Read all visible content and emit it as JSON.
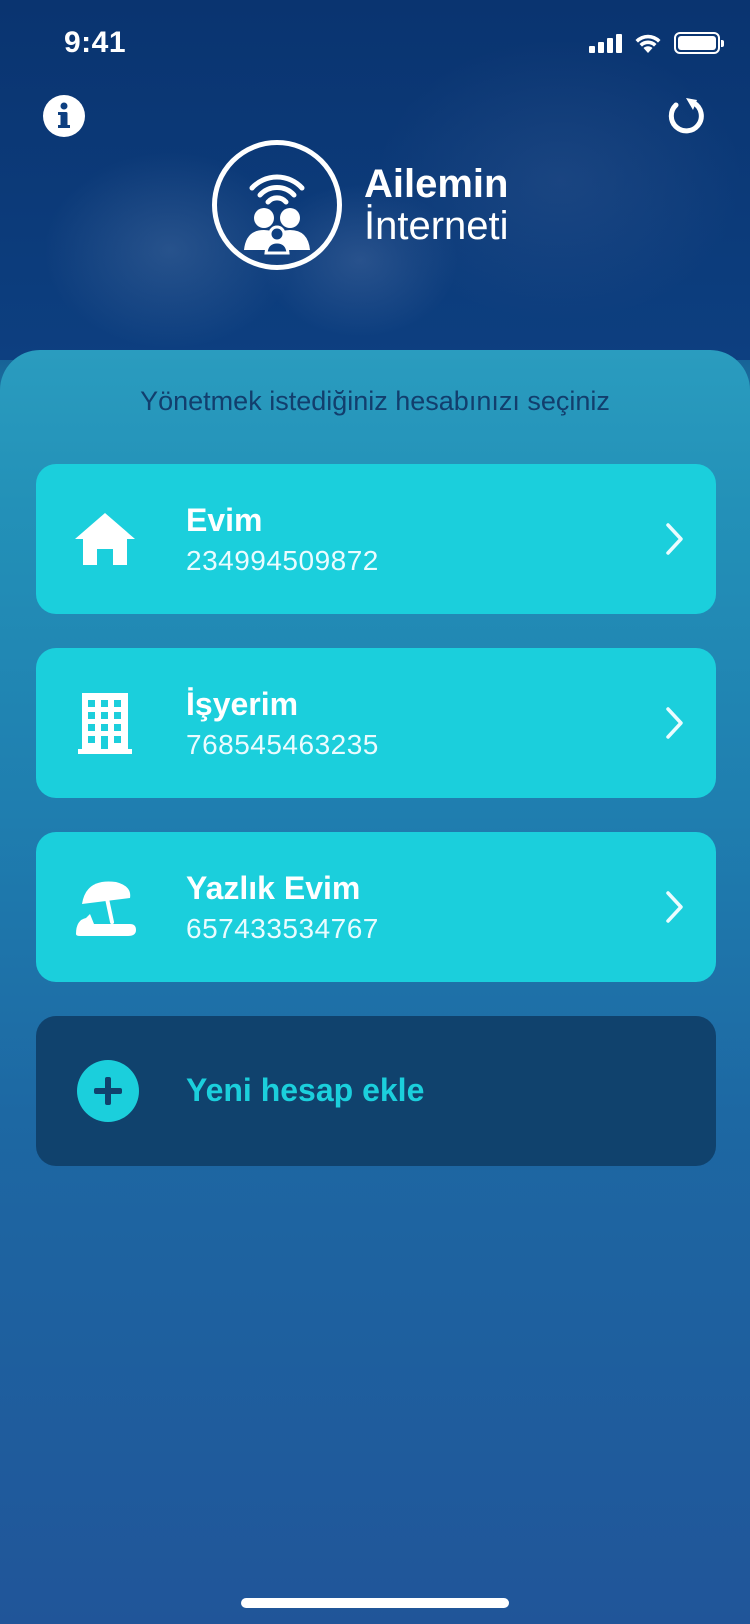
{
  "status_bar": {
    "time": "9:41"
  },
  "header": {
    "logo_line1": "Ailemin",
    "logo_line2": "İnterneti"
  },
  "panel": {
    "title": "Yönetmek istediğiniz hesabınızı seçiniz"
  },
  "accounts": [
    {
      "name": "Evim",
      "number": "234994509872",
      "icon": "home-icon"
    },
    {
      "name": "İşyerim",
      "number": "768545463235",
      "icon": "building-icon"
    },
    {
      "name": "Yazlık Evim",
      "number": "657433534767",
      "icon": "beach-umbrella-icon"
    }
  ],
  "add_account": {
    "label": "Yeni hesap ekle"
  },
  "colors": {
    "accent": "#1bcfdc",
    "dark_card": "#10426d",
    "title_text": "#123e6d"
  }
}
